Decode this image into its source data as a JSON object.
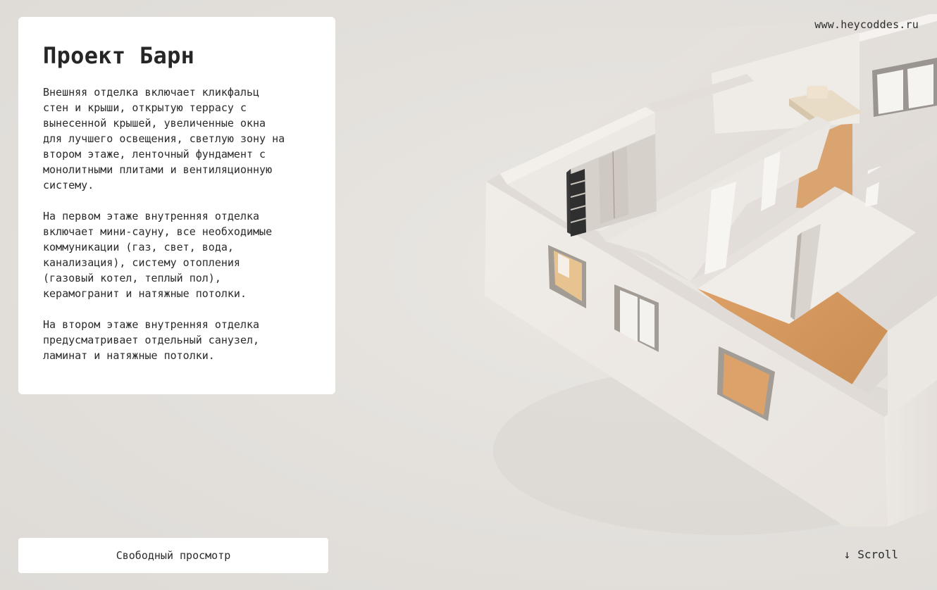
{
  "site": {
    "url_text": "www.heycoddes.ru"
  },
  "card": {
    "title": "Проект Барн",
    "paragraphs": [
      "Внешняя отделка включает кликфальц\nстен и крыши, открытую террасу с\nвынесенной крышей, увеличенные окна\nдля лучшего освещения, светлую зону на\nвтором этаже, ленточный фундамент с\nмонолитными плитами и вентиляционную\nсистему.",
      "На первом этаже внутренняя отделка\nвключает мини-сауну, все необходимые\nкоммуникации (газ, свет, вода,\nканализация), систему отопления\n(газовый котел, теплый пол),\nкерамогранит и натяжные потолки.",
      "На втором этаже внутренняя отделка\nпредусматривает отдельный санузел,\nламинат и натяжные потолки."
    ]
  },
  "controls": {
    "free_view_label": "Свободный просмотр",
    "scroll_label": "Scroll",
    "scroll_icon": "arrow-down-icon"
  },
  "colors": {
    "background": "#e3e0dc",
    "card": "#ffffff",
    "wall": "#f1edea",
    "floor": "#d89a5e"
  }
}
